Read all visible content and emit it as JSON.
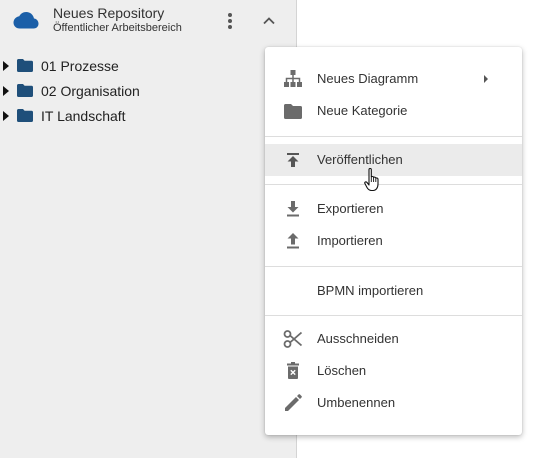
{
  "repository": {
    "title": "Neues Repository",
    "subtitle": "Öffentlicher Arbeitsbereich",
    "icon": "cloud-icon",
    "icon_color": "#1b5fa8"
  },
  "tree": {
    "folder_color": "#1f4f7a",
    "items": [
      {
        "label": "01 Prozesse",
        "icon": "folder-icon"
      },
      {
        "label": "02 Organisation",
        "icon": "folder-icon"
      },
      {
        "label": "IT Landschaft",
        "icon": "folder-icon"
      }
    ]
  },
  "context_menu": {
    "hovered_item": "Veröffentlichen",
    "items": [
      {
        "label": "Neues Diagramm",
        "icon": "diagram-hierarchy-icon",
        "has_submenu": true
      },
      {
        "label": "Neue Kategorie",
        "icon": "folder-icon"
      },
      {
        "label": "Veröffentlichen",
        "icon": "publish-icon"
      },
      {
        "label": "Exportieren",
        "icon": "download-icon"
      },
      {
        "label": "Importieren",
        "icon": "upload-icon"
      },
      {
        "label": "BPMN importieren",
        "icon": ""
      },
      {
        "label": "Ausschneiden",
        "icon": "scissors-icon"
      },
      {
        "label": "Löschen",
        "icon": "trash-icon"
      },
      {
        "label": "Umbenennen",
        "icon": "pencil-icon"
      }
    ]
  }
}
